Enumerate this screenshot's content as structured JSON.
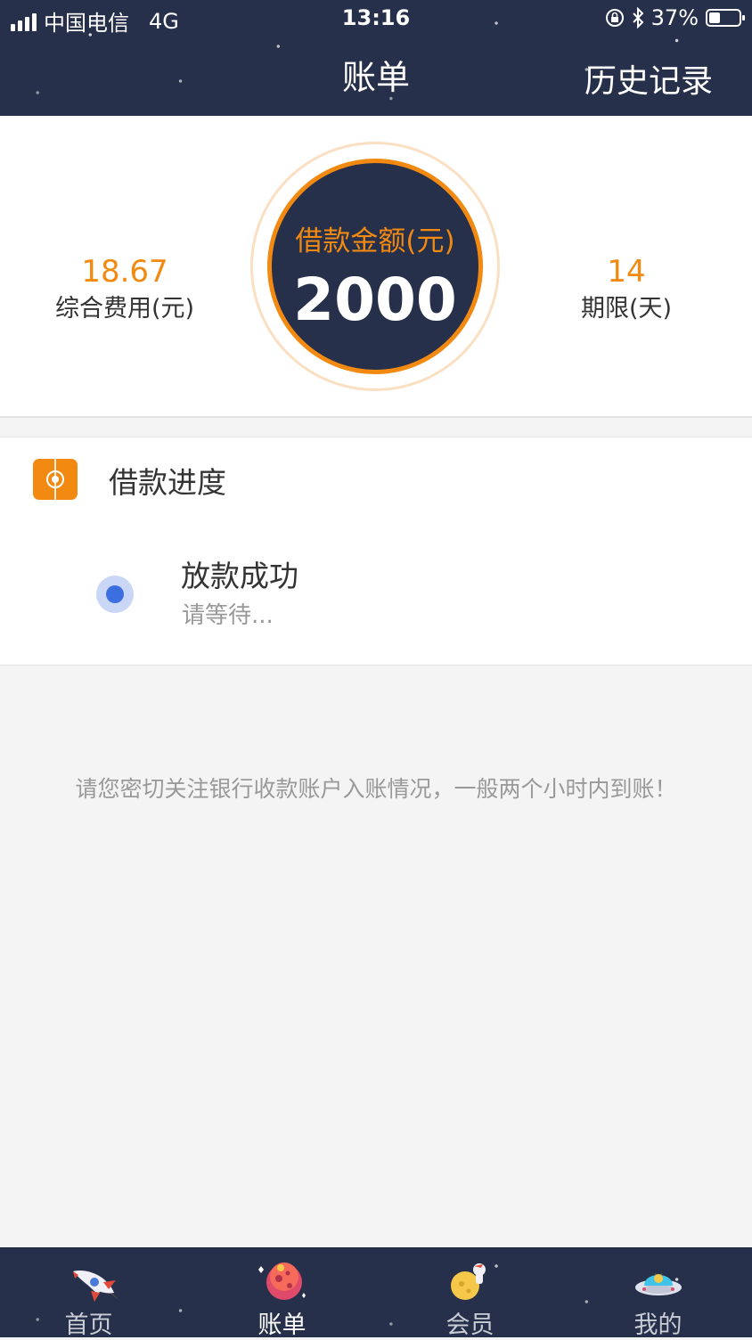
{
  "status_bar": {
    "carrier": "中国电信",
    "network": "4G",
    "time": "13:16",
    "battery": "37%"
  },
  "header": {
    "title": "账单",
    "history_label": "历史记录"
  },
  "summary": {
    "fee_value": "18.67",
    "fee_label": "综合费用(元)",
    "amount_label": "借款金额(元)",
    "amount_value": "2000",
    "term_value": "14",
    "term_label": "期限(天)"
  },
  "progress": {
    "title": "借款进度",
    "step_title": "放款成功",
    "step_subtitle": "请等待..."
  },
  "notice": "请您密切关注银行收款账户入账情况，一般两个小时内到账！",
  "nav": {
    "items": [
      {
        "label": "首页",
        "icon": "rocket-icon"
      },
      {
        "label": "账单",
        "icon": "planet-icon",
        "active": true
      },
      {
        "label": "会员",
        "icon": "moon-astronaut-icon"
      },
      {
        "label": "我的",
        "icon": "ufo-icon"
      }
    ]
  },
  "colors": {
    "accent": "#f28a12",
    "navy": "#27304a",
    "progress_dot": "#3b6fe0"
  }
}
